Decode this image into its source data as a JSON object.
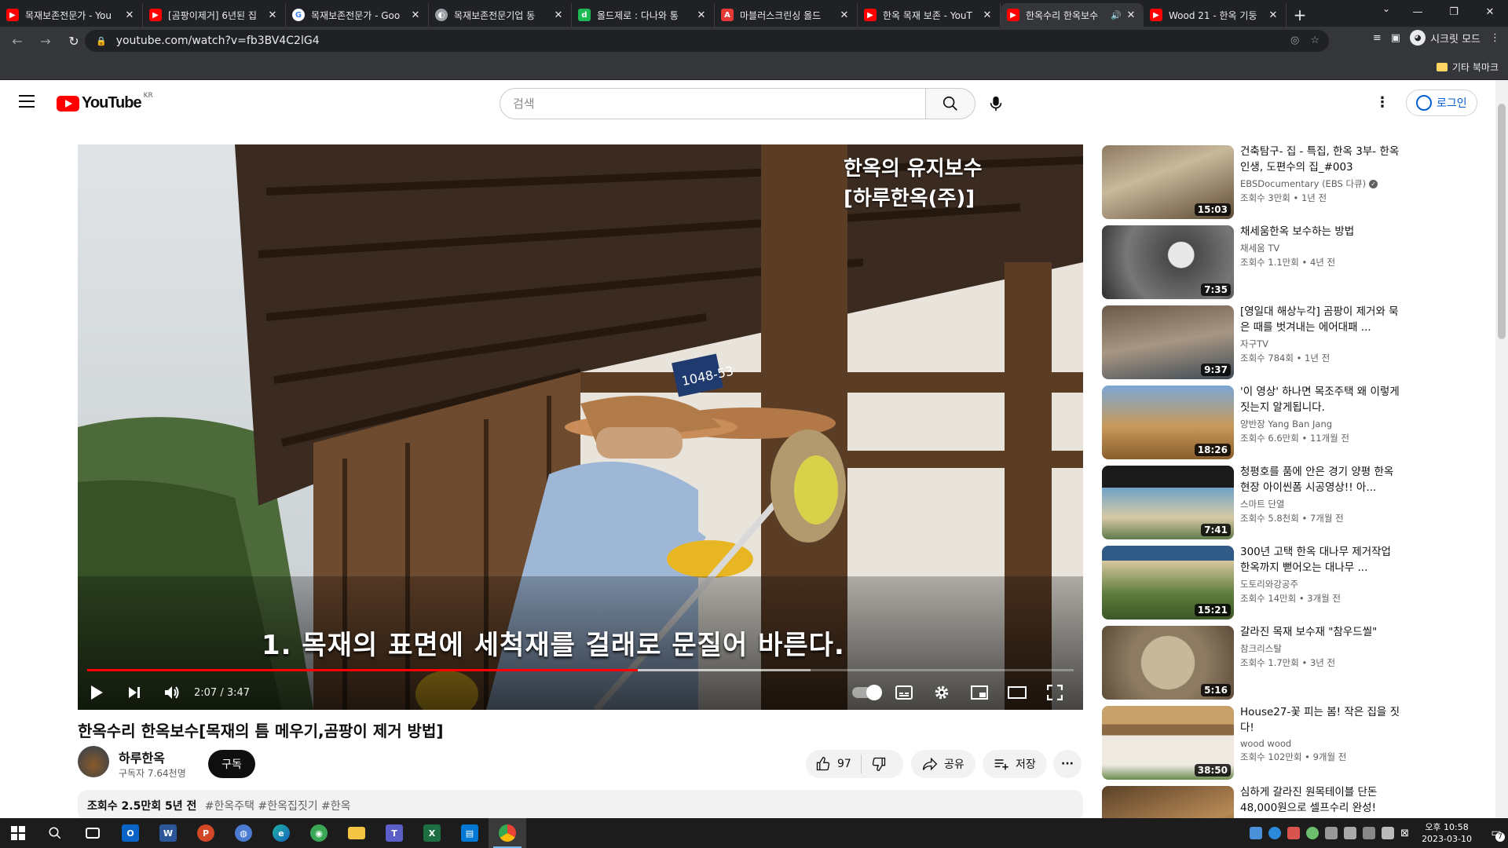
{
  "browser": {
    "tabs": [
      {
        "title": "목재보존전문가 - You",
        "favicon": "youtube-icon"
      },
      {
        "title": "[곰팡이제거] 6년된 집",
        "favicon": "youtube-icon"
      },
      {
        "title": "목재보존전문가 - Goo",
        "favicon": "google-icon"
      },
      {
        "title": "목재보존전문기업 동",
        "favicon": "web-icon"
      },
      {
        "title": "올드제로 : 다나와 통",
        "favicon": "danawa-icon"
      },
      {
        "title": "마블러스크린싱 올드",
        "favicon": "store-icon"
      },
      {
        "title": "한옥 목재 보존 - YouT",
        "favicon": "youtube-icon"
      },
      {
        "title": "한옥수리 한옥보수",
        "favicon": "youtube-icon",
        "active": true,
        "audio": true
      },
      {
        "title": "Wood 21 - 한옥 기둥",
        "favicon": "youtube-icon"
      }
    ],
    "url": "youtube.com/watch?v=fb3BV4C2lG4",
    "incognito_label": "시크릿 모드",
    "bookmarks_other": "기타 북마크"
  },
  "youtube": {
    "logo_region": "KR",
    "logo_text": "YouTube",
    "search_placeholder": "검색",
    "login_label": "로그인",
    "player": {
      "overlay_title_line1": "한옥의 유지보수",
      "overlay_title_line2": "[하루한옥(주)]",
      "subtitle": "1. 목재의 표면에 세척재를 걸래로 문질어 바른다.",
      "time": "2:07 / 3:47",
      "progress_played_fraction": 0.558,
      "progress_buffer_fraction": 0.733,
      "house_sign": "1048-53"
    },
    "video": {
      "title": "한옥수리 한옥보수[목재의 틈 메우기,곰팡이 제거 방법]",
      "channel": "하루한옥",
      "subscribers": "구독자 7.64천명",
      "subscribe_label": "구독",
      "likes": "97",
      "share_label": "공유",
      "save_label": "저장",
      "views_age": "조회수 2.5만회  5년 전",
      "tags": "#한옥주택 #한옥집짓기 #한옥"
    },
    "recommendations": [
      {
        "title": "건축탐구- 집 - 특집, 한옥 3부- 한옥 인생, 도편수의 집_#003",
        "channel": "EBSDocumentary (EBS 다큐)",
        "verified": true,
        "meta": "조회수 3만회 • 1년 전",
        "duration": "15:03"
      },
      {
        "title": "채세움한옥 보수하는 방법",
        "channel": "채세움 TV",
        "verified": false,
        "meta": "조회수 1.1만회 • 4년 전",
        "duration": "7:35"
      },
      {
        "title": "[영일대 해상누각] 곰팡이 제거와 묵은 때를 벗겨내는 에어대패 ...",
        "channel": "자구TV",
        "verified": false,
        "meta": "조회수 784회 • 1년 전",
        "duration": "9:37"
      },
      {
        "title": "'이 영상' 하나면 목조주택 왜 이렇게 짓는지 알게됩니다.",
        "channel": "양반장 Yang Ban Jang",
        "verified": false,
        "meta": "조회수 6.6만회 • 11개월 전",
        "duration": "18:26"
      },
      {
        "title": "청평호를 품에 안은 경기 양평 한옥 현장 아이씬폼 시공영상!! 아...",
        "channel": "스마트 단열",
        "verified": false,
        "meta": "조회수 5.8천회 • 7개월 전",
        "duration": "7:41"
      },
      {
        "title": "300년 고택 한옥 대나무 제거작업 한옥까지 뻗어오는 대나무 ...",
        "channel": "도토리와강공주",
        "verified": false,
        "meta": "조회수 14만회 • 3개월 전",
        "duration": "15:21"
      },
      {
        "title": "갈라진 목재 보수재 \"참우드씰\"",
        "channel": "참크리스탈",
        "verified": false,
        "meta": "조회수 1.7만회 • 3년 전",
        "duration": "5:16"
      },
      {
        "title": "House27-꽃 피는 봄! 작은 집을 짓다!",
        "channel": "wood wood",
        "verified": false,
        "meta": "조회수 102만회 • 9개월 전",
        "duration": "38:50"
      },
      {
        "title": "심하게 갈라진 원목테이블 단돈 48,000원으로 셀프수리 완성!",
        "channel": "",
        "verified": false,
        "meta": "",
        "duration": ""
      }
    ]
  },
  "taskbar": {
    "clock_time": "오후 10:58",
    "clock_date": "2023-03-10",
    "notification_count": "7"
  },
  "colors": {
    "youtube_red": "#ff0000",
    "link_blue": "#065fd4",
    "chrome_dark": "#202124",
    "chrome_toolbar": "#35363a"
  }
}
